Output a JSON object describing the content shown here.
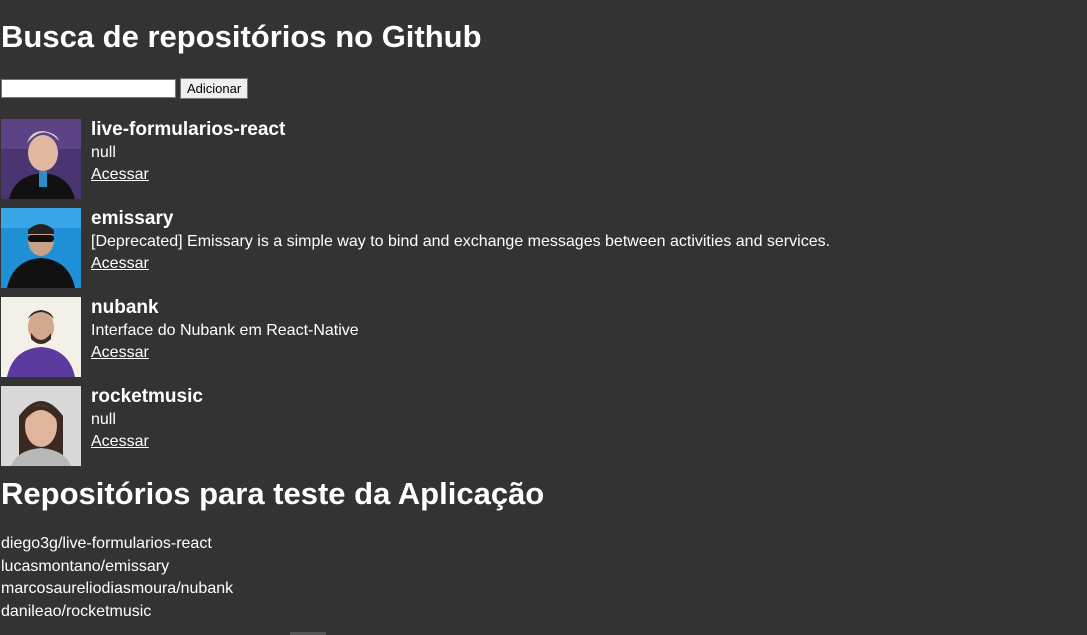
{
  "header": {
    "title": "Busca de repositórios no Github"
  },
  "form": {
    "input_value": "",
    "input_placeholder": "",
    "add_button_label": "Adicionar"
  },
  "repositories": [
    {
      "name": "live-formularios-react",
      "description": "null",
      "link_label": "Acessar",
      "avatar_bg": "#4a3572"
    },
    {
      "name": "emissary",
      "description": "[Deprecated] Emissary is a simple way to bind and exchange messages between activities and services.",
      "link_label": "Acessar",
      "avatar_bg": "#1f8fd6"
    },
    {
      "name": "nubank",
      "description": "Interface do Nubank em React-Native",
      "link_label": "Acessar",
      "avatar_bg": "#f3efe9"
    },
    {
      "name": "rocketmusic",
      "description": "null",
      "link_label": "Acessar",
      "avatar_bg": "#d9d9d9"
    }
  ],
  "test_section": {
    "title": "Repositórios para teste da Aplicação",
    "items": [
      "diego3g/live-formularios-react",
      "lucasmontano/emissary",
      "marcosaureliodiasmoura/nubank",
      "danileao/rocketmusic"
    ]
  },
  "colors": {
    "background": "#333333",
    "text": "#ffffff"
  }
}
